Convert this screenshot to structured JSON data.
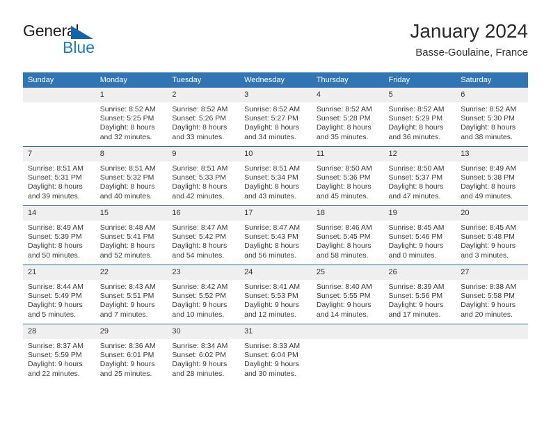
{
  "brand": {
    "name_line1": "General",
    "name_line2": "Blue",
    "triangle_color": "#1464aa",
    "blue_text_color": "#1a7cc4"
  },
  "header": {
    "title": "January 2024",
    "subtitle": "Basse-Goulaine, France",
    "header_bg_color": "#3175b4",
    "row_divider_color": "#2e6fa8",
    "date_band_color": "#efefef"
  },
  "weekdays": [
    "Sunday",
    "Monday",
    "Tuesday",
    "Wednesday",
    "Thursday",
    "Friday",
    "Saturday"
  ],
  "labels": {
    "sunrise_prefix": "Sunrise:",
    "sunset_prefix": "Sunset:",
    "daylight_prefix": "Daylight:"
  },
  "weeks": [
    [
      {
        "date": "",
        "empty": true
      },
      {
        "date": "1",
        "sunrise": "Sunrise: 8:52 AM",
        "sunset": "Sunset: 5:25 PM",
        "daylight_l1": "Daylight: 8 hours",
        "daylight_l2": "and 32 minutes."
      },
      {
        "date": "2",
        "sunrise": "Sunrise: 8:52 AM",
        "sunset": "Sunset: 5:26 PM",
        "daylight_l1": "Daylight: 8 hours",
        "daylight_l2": "and 33 minutes."
      },
      {
        "date": "3",
        "sunrise": "Sunrise: 8:52 AM",
        "sunset": "Sunset: 5:27 PM",
        "daylight_l1": "Daylight: 8 hours",
        "daylight_l2": "and 34 minutes."
      },
      {
        "date": "4",
        "sunrise": "Sunrise: 8:52 AM",
        "sunset": "Sunset: 5:28 PM",
        "daylight_l1": "Daylight: 8 hours",
        "daylight_l2": "and 35 minutes."
      },
      {
        "date": "5",
        "sunrise": "Sunrise: 8:52 AM",
        "sunset": "Sunset: 5:29 PM",
        "daylight_l1": "Daylight: 8 hours",
        "daylight_l2": "and 36 minutes."
      },
      {
        "date": "6",
        "sunrise": "Sunrise: 8:52 AM",
        "sunset": "Sunset: 5:30 PM",
        "daylight_l1": "Daylight: 8 hours",
        "daylight_l2": "and 38 minutes."
      }
    ],
    [
      {
        "date": "7",
        "sunrise": "Sunrise: 8:51 AM",
        "sunset": "Sunset: 5:31 PM",
        "daylight_l1": "Daylight: 8 hours",
        "daylight_l2": "and 39 minutes."
      },
      {
        "date": "8",
        "sunrise": "Sunrise: 8:51 AM",
        "sunset": "Sunset: 5:32 PM",
        "daylight_l1": "Daylight: 8 hours",
        "daylight_l2": "and 40 minutes."
      },
      {
        "date": "9",
        "sunrise": "Sunrise: 8:51 AM",
        "sunset": "Sunset: 5:33 PM",
        "daylight_l1": "Daylight: 8 hours",
        "daylight_l2": "and 42 minutes."
      },
      {
        "date": "10",
        "sunrise": "Sunrise: 8:51 AM",
        "sunset": "Sunset: 5:34 PM",
        "daylight_l1": "Daylight: 8 hours",
        "daylight_l2": "and 43 minutes."
      },
      {
        "date": "11",
        "sunrise": "Sunrise: 8:50 AM",
        "sunset": "Sunset: 5:36 PM",
        "daylight_l1": "Daylight: 8 hours",
        "daylight_l2": "and 45 minutes."
      },
      {
        "date": "12",
        "sunrise": "Sunrise: 8:50 AM",
        "sunset": "Sunset: 5:37 PM",
        "daylight_l1": "Daylight: 8 hours",
        "daylight_l2": "and 47 minutes."
      },
      {
        "date": "13",
        "sunrise": "Sunrise: 8:49 AM",
        "sunset": "Sunset: 5:38 PM",
        "daylight_l1": "Daylight: 8 hours",
        "daylight_l2": "and 49 minutes."
      }
    ],
    [
      {
        "date": "14",
        "sunrise": "Sunrise: 8:49 AM",
        "sunset": "Sunset: 5:39 PM",
        "daylight_l1": "Daylight: 8 hours",
        "daylight_l2": "and 50 minutes."
      },
      {
        "date": "15",
        "sunrise": "Sunrise: 8:48 AM",
        "sunset": "Sunset: 5:41 PM",
        "daylight_l1": "Daylight: 8 hours",
        "daylight_l2": "and 52 minutes."
      },
      {
        "date": "16",
        "sunrise": "Sunrise: 8:47 AM",
        "sunset": "Sunset: 5:42 PM",
        "daylight_l1": "Daylight: 8 hours",
        "daylight_l2": "and 54 minutes."
      },
      {
        "date": "17",
        "sunrise": "Sunrise: 8:47 AM",
        "sunset": "Sunset: 5:43 PM",
        "daylight_l1": "Daylight: 8 hours",
        "daylight_l2": "and 56 minutes."
      },
      {
        "date": "18",
        "sunrise": "Sunrise: 8:46 AM",
        "sunset": "Sunset: 5:45 PM",
        "daylight_l1": "Daylight: 8 hours",
        "daylight_l2": "and 58 minutes."
      },
      {
        "date": "19",
        "sunrise": "Sunrise: 8:45 AM",
        "sunset": "Sunset: 5:46 PM",
        "daylight_l1": "Daylight: 9 hours",
        "daylight_l2": "and 0 minutes."
      },
      {
        "date": "20",
        "sunrise": "Sunrise: 8:45 AM",
        "sunset": "Sunset: 5:48 PM",
        "daylight_l1": "Daylight: 9 hours",
        "daylight_l2": "and 3 minutes."
      }
    ],
    [
      {
        "date": "21",
        "sunrise": "Sunrise: 8:44 AM",
        "sunset": "Sunset: 5:49 PM",
        "daylight_l1": "Daylight: 9 hours",
        "daylight_l2": "and 5 minutes."
      },
      {
        "date": "22",
        "sunrise": "Sunrise: 8:43 AM",
        "sunset": "Sunset: 5:51 PM",
        "daylight_l1": "Daylight: 9 hours",
        "daylight_l2": "and 7 minutes."
      },
      {
        "date": "23",
        "sunrise": "Sunrise: 8:42 AM",
        "sunset": "Sunset: 5:52 PM",
        "daylight_l1": "Daylight: 9 hours",
        "daylight_l2": "and 10 minutes."
      },
      {
        "date": "24",
        "sunrise": "Sunrise: 8:41 AM",
        "sunset": "Sunset: 5:53 PM",
        "daylight_l1": "Daylight: 9 hours",
        "daylight_l2": "and 12 minutes."
      },
      {
        "date": "25",
        "sunrise": "Sunrise: 8:40 AM",
        "sunset": "Sunset: 5:55 PM",
        "daylight_l1": "Daylight: 9 hours",
        "daylight_l2": "and 14 minutes."
      },
      {
        "date": "26",
        "sunrise": "Sunrise: 8:39 AM",
        "sunset": "Sunset: 5:56 PM",
        "daylight_l1": "Daylight: 9 hours",
        "daylight_l2": "and 17 minutes."
      },
      {
        "date": "27",
        "sunrise": "Sunrise: 8:38 AM",
        "sunset": "Sunset: 5:58 PM",
        "daylight_l1": "Daylight: 9 hours",
        "daylight_l2": "and 20 minutes."
      }
    ],
    [
      {
        "date": "28",
        "sunrise": "Sunrise: 8:37 AM",
        "sunset": "Sunset: 5:59 PM",
        "daylight_l1": "Daylight: 9 hours",
        "daylight_l2": "and 22 minutes."
      },
      {
        "date": "29",
        "sunrise": "Sunrise: 8:36 AM",
        "sunset": "Sunset: 6:01 PM",
        "daylight_l1": "Daylight: 9 hours",
        "daylight_l2": "and 25 minutes."
      },
      {
        "date": "30",
        "sunrise": "Sunrise: 8:34 AM",
        "sunset": "Sunset: 6:02 PM",
        "daylight_l1": "Daylight: 9 hours",
        "daylight_l2": "and 28 minutes."
      },
      {
        "date": "31",
        "sunrise": "Sunrise: 8:33 AM",
        "sunset": "Sunset: 6:04 PM",
        "daylight_l1": "Daylight: 9 hours",
        "daylight_l2": "and 30 minutes."
      },
      {
        "date": "",
        "empty": true
      },
      {
        "date": "",
        "empty": true
      },
      {
        "date": "",
        "empty": true
      }
    ]
  ]
}
